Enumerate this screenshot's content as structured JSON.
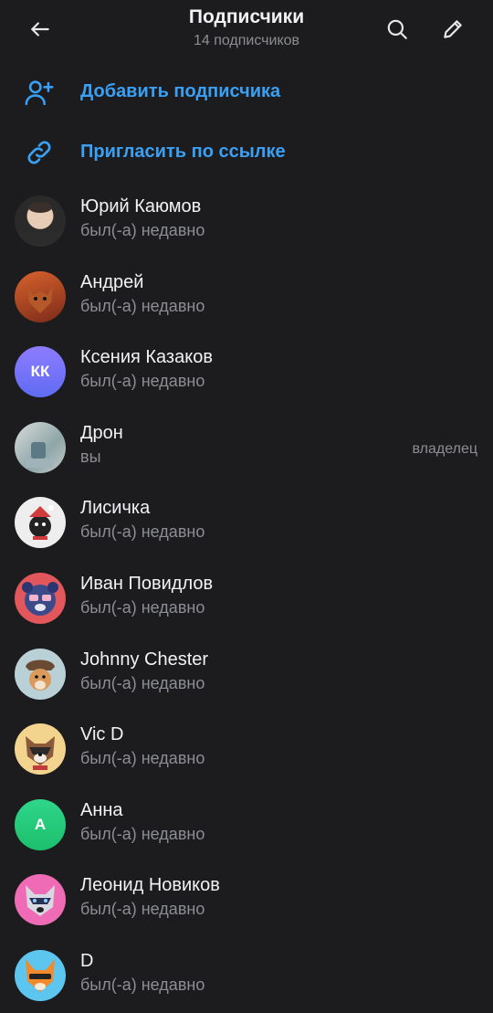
{
  "header": {
    "title": "Подписчики",
    "subtitle": "14 подписчиков"
  },
  "actions": {
    "add_label": "Добавить подписчика",
    "invite_label": "Пригласить по ссылке"
  },
  "colors": {
    "background": "#1c1c1f",
    "accent": "#3aa0f3",
    "secondary_text": "#8d8e93"
  },
  "subscribers": [
    {
      "name": "Юрий Каюмов",
      "status": "был(-а) недавно"
    },
    {
      "name": "Андрей",
      "status": "был(-а) недавно"
    },
    {
      "name": "Ксения Казаков",
      "status": "был(-а) недавно",
      "initials": "КК"
    },
    {
      "name": "Дрон",
      "status": "вы",
      "role": "владелец"
    },
    {
      "name": "Лисичка",
      "status": "был(-а) недавно"
    },
    {
      "name": "Иван Повидлов",
      "status": "был(-а) недавно"
    },
    {
      "name": "Johnny Chester",
      "status": "был(-а) недавно"
    },
    {
      "name": "Vic D",
      "status": "был(-а) недавно"
    },
    {
      "name": "Анна",
      "status": "был(-а) недавно",
      "initials": "А"
    },
    {
      "name": "Леонид Новиков",
      "status": "был(-а) недавно"
    },
    {
      "name": "D",
      "status": "был(-а) недавно"
    }
  ]
}
